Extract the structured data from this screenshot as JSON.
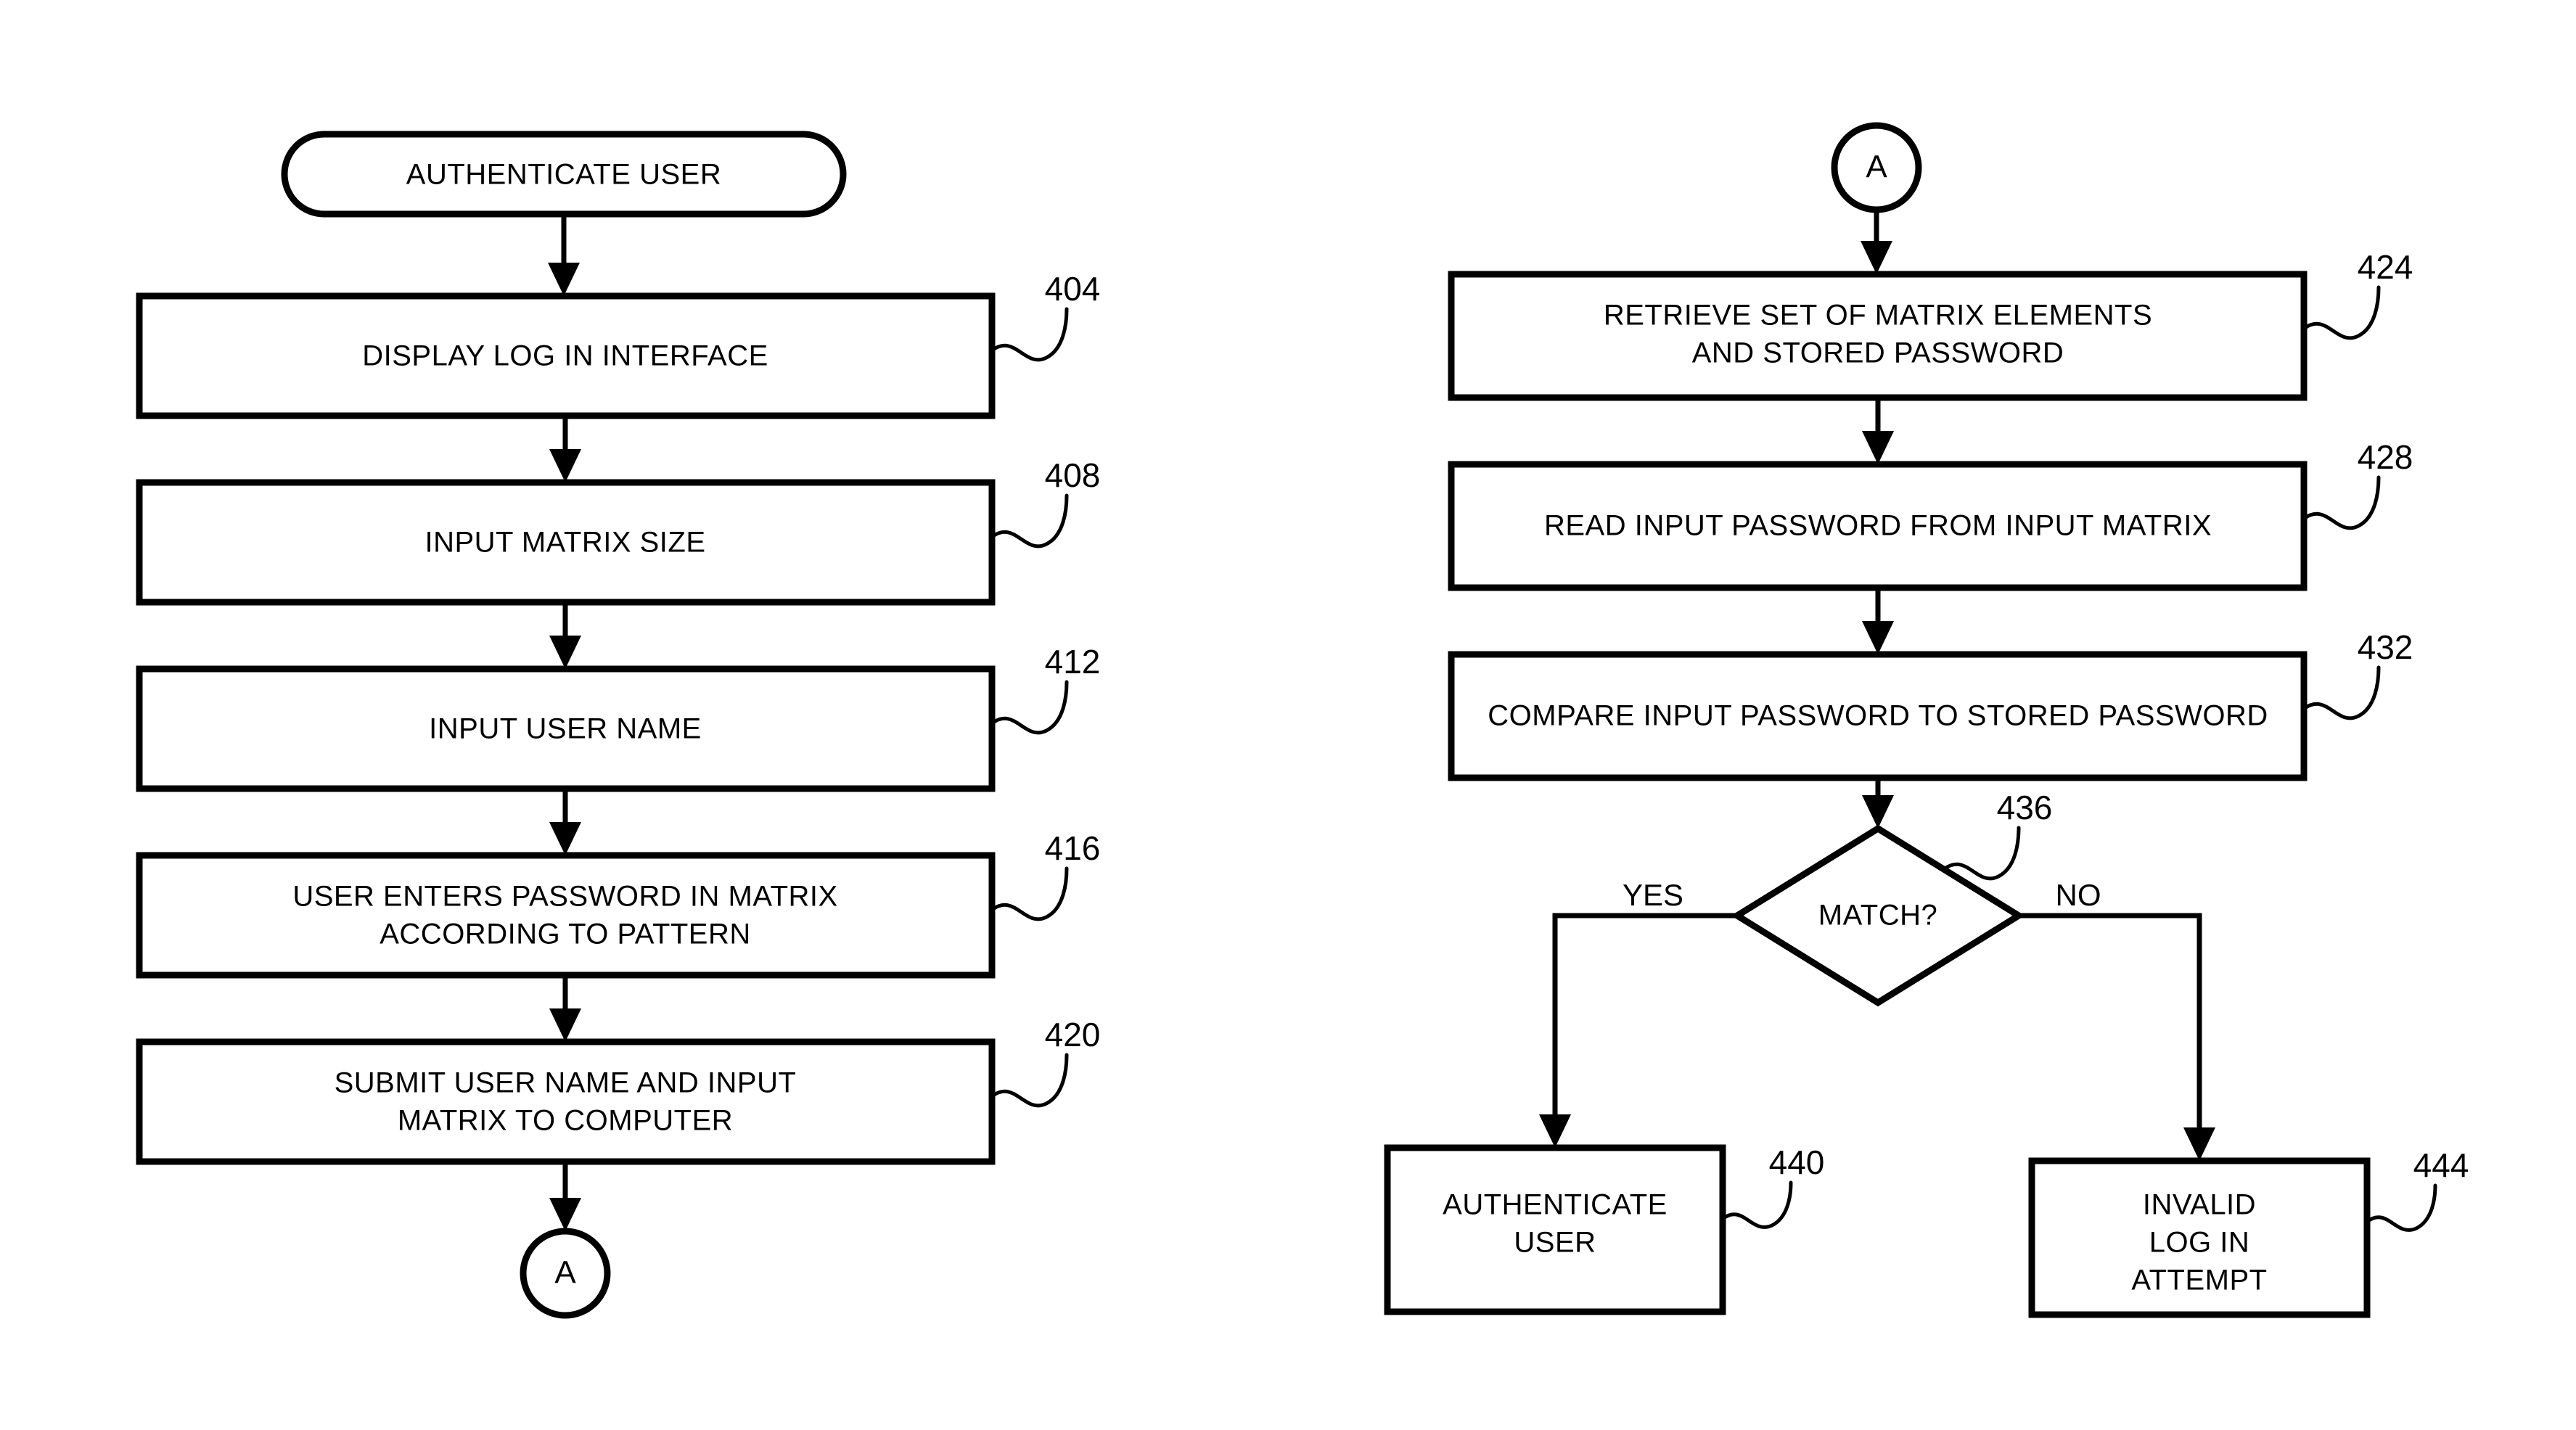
{
  "diagram": {
    "title": "AUTHENTICATE USER",
    "left_column": {
      "start_terminal": {
        "label": "AUTHENTICATE USER",
        "shape": "rounded-terminal"
      },
      "steps": [
        {
          "ref": "404",
          "lines": [
            "DISPLAY LOG IN INTERFACE"
          ]
        },
        {
          "ref": "408",
          "lines": [
            "INPUT MATRIX SIZE"
          ]
        },
        {
          "ref": "412",
          "lines": [
            "INPUT USER NAME"
          ]
        },
        {
          "ref": "416",
          "lines": [
            "USER ENTERS PASSWORD IN MATRIX",
            "ACCORDING TO PATTERN"
          ]
        },
        {
          "ref": "420",
          "lines": [
            "SUBMIT USER NAME AND INPUT",
            "MATRIX TO COMPUTER"
          ]
        }
      ],
      "end_connector": {
        "label": "A",
        "shape": "circle"
      }
    },
    "right_column": {
      "start_connector": {
        "label": "A",
        "shape": "circle"
      },
      "steps": [
        {
          "ref": "424",
          "lines": [
            "RETRIEVE SET OF MATRIX ELEMENTS",
            "AND STORED PASSWORD"
          ]
        },
        {
          "ref": "428",
          "lines": [
            "READ INPUT PASSWORD FROM INPUT MATRIX"
          ]
        },
        {
          "ref": "432",
          "lines": [
            "COMPARE INPUT PASSWORD TO STORED PASSWORD"
          ]
        }
      ],
      "decision": {
        "ref": "436",
        "label": "MATCH?",
        "yes_label": "YES",
        "no_label": "NO"
      },
      "outcomes": [
        {
          "ref": "440",
          "lines": [
            "AUTHENTICATE",
            "USER"
          ],
          "branch": "YES"
        },
        {
          "ref": "444",
          "lines": [
            "INVALID",
            "LOG IN",
            "ATTEMPT"
          ],
          "branch": "NO"
        }
      ]
    },
    "colors": {
      "stroke": "#000000",
      "fill": "#ffffff",
      "background": "#ffffff"
    }
  }
}
